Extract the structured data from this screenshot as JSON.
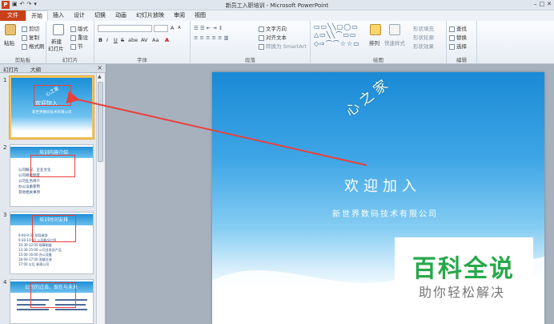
{
  "window": {
    "title": "新员工入职培训 - Microsoft PowerPoint",
    "app_icon": "P",
    "qat": [
      "save-icon",
      "undo-icon",
      "redo-icon",
      "customize-icon"
    ],
    "controls": [
      "minimize-icon",
      "maximize-icon",
      "close-icon"
    ]
  },
  "tabs": [
    "文件",
    "开始",
    "插入",
    "设计",
    "切换",
    "动画",
    "幻灯片放映",
    "审阅",
    "视图"
  ],
  "ribbon": {
    "clipboard": {
      "paste": "粘贴",
      "cut": "剪切",
      "copy": "复制",
      "format_painter": "格式刷",
      "label": "剪贴板"
    },
    "slides": {
      "new_slide": "新建",
      "new_slide2": "幻灯片",
      "layout": "版式",
      "reset": "重设",
      "section": "节",
      "label": "幻灯片"
    },
    "font": {
      "label": "字体",
      "bold": "B",
      "italic": "I",
      "underline": "U",
      "strike": "S",
      "shadow": "abe",
      "spacing": "AV",
      "case": "Aa",
      "grow": "A",
      "shrink": "A"
    },
    "paragraph": {
      "label": "段落",
      "text_direction": "文字方向",
      "align_text": "对齐文本",
      "smartart": "转换为 SmartArt"
    },
    "drawing": {
      "arrange": "排列",
      "quick_styles": "快速样式",
      "fill": "形状填充",
      "outline": "形状轮廓",
      "effects": "形状效果",
      "label": "绘图"
    },
    "editing": {
      "find": "查找",
      "replace": "替换",
      "select": "选择",
      "label": "编辑"
    }
  },
  "left_pane": {
    "tab_slides": "幻灯片",
    "tab_outline": "大纲",
    "close": "×",
    "slides": [
      {
        "num": "1",
        "title": "欢迎加入",
        "arc": "心之家",
        "sub": "新世界数码技术有限公司"
      },
      {
        "num": "2",
        "title": "培训内容介绍",
        "items": [
          "公司概况、企业文化",
          "公司规章制度",
          "公司业务简介",
          "办公设备使用",
          "其他相关事项"
        ]
      },
      {
        "num": "3",
        "title": "培训时间安排",
        "items": [
          "9:00-9:30 领导致辞",
          "9:30-10:30 公司概况介绍",
          "10:30-12:00 规章制度",
          "13:30-15:00 公司业务及产品",
          "15:00-16:00 办公设备",
          "16:00-17:00 答疑交流",
          "17:00 以后 参观公司"
        ]
      },
      {
        "num": "4",
        "title": "公司的过去、现在与未来"
      }
    ]
  },
  "slide": {
    "arc_title": "心之家",
    "title": "欢迎加入",
    "subtitle": "新世界数码技术有限公司"
  },
  "watermark": {
    "line1": "百科全说",
    "line2": "助你轻松解决"
  },
  "colors": {
    "file_tab": "#c8401a",
    "sky_top": "#1a8ad6",
    "annotation": "#e8413d",
    "watermark_green": "#27a84a"
  }
}
